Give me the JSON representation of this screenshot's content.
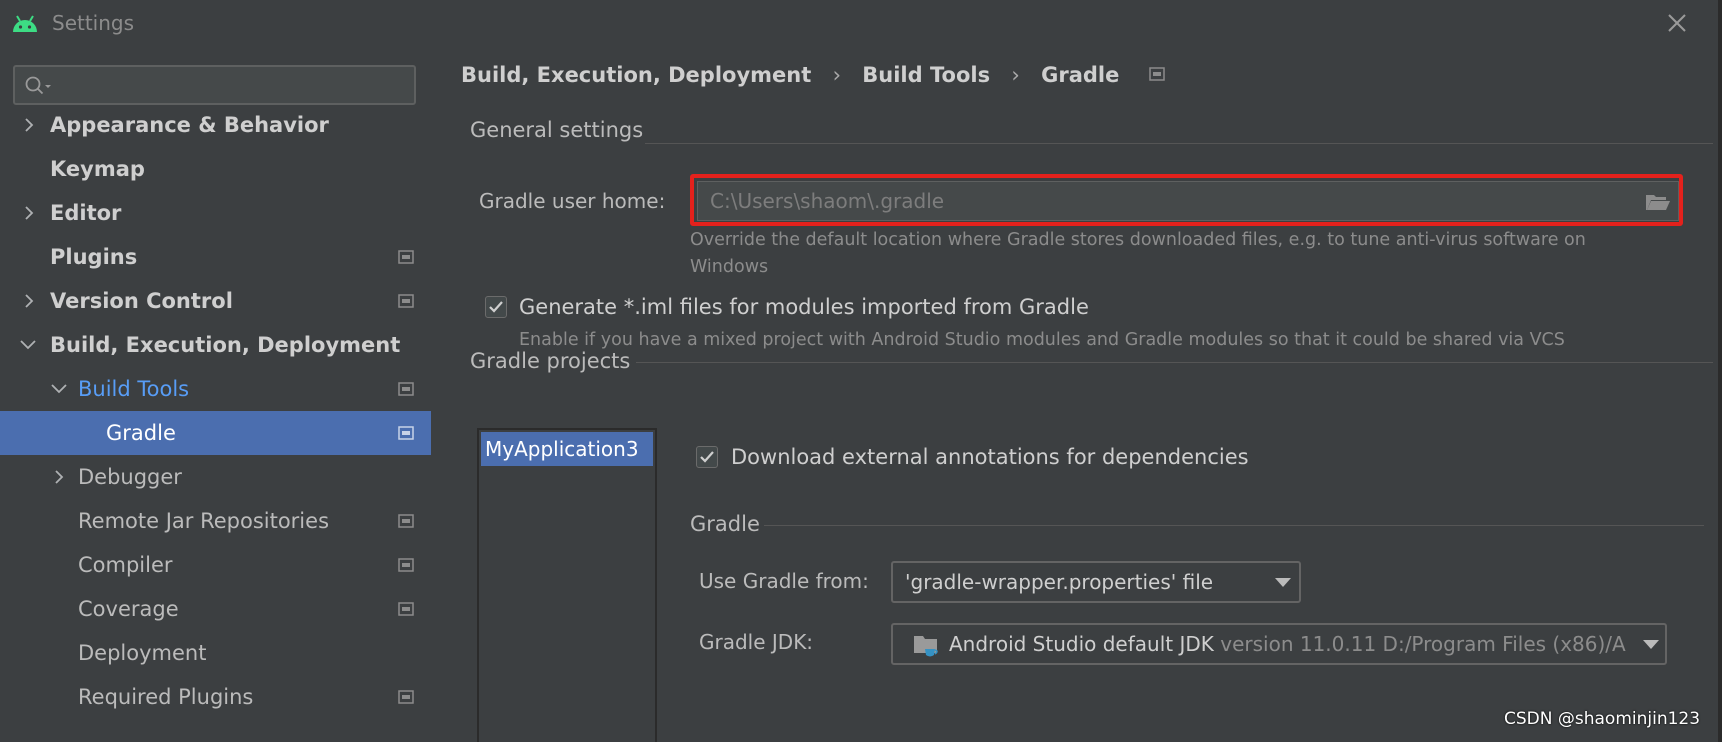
{
  "window": {
    "title": "Settings"
  },
  "search": {
    "placeholder": ""
  },
  "sidebar": {
    "items": [
      {
        "label": "Appearance & Behavior"
      },
      {
        "label": "Keymap"
      },
      {
        "label": "Editor"
      },
      {
        "label": "Plugins"
      },
      {
        "label": "Version Control"
      },
      {
        "label": "Build, Execution, Deployment"
      },
      {
        "label": "Build Tools"
      },
      {
        "label": "Gradle"
      },
      {
        "label": "Debugger"
      },
      {
        "label": "Remote Jar Repositories"
      },
      {
        "label": "Compiler"
      },
      {
        "label": "Coverage"
      },
      {
        "label": "Deployment"
      },
      {
        "label": "Required Plugins"
      }
    ]
  },
  "breadcrumb": {
    "items": [
      "Build, Execution, Deployment",
      "Build Tools",
      "Gradle"
    ],
    "separator": "›"
  },
  "general": {
    "section_title": "General settings",
    "user_home_label": "Gradle user home:",
    "user_home_value": "C:\\Users\\shaom\\.gradle",
    "user_home_hint_line1": "Override the default location where Gradle stores downloaded files, e.g. to tune anti-virus software on",
    "user_home_hint_line2": "Windows",
    "generate_iml_label": "Generate *.iml files for modules imported from Gradle",
    "generate_iml_checked": true,
    "generate_iml_hint": "Enable if you have a mixed project with Android Studio modules and Gradle modules so that it could be shared via VCS"
  },
  "projects": {
    "section_title": "Gradle projects",
    "list": [
      "MyApplication3"
    ],
    "download_annotations_label": "Download external annotations for dependencies",
    "download_annotations_checked": true,
    "gradle_section_title": "Gradle",
    "use_gradle_from_label": "Use Gradle from:",
    "use_gradle_from_value": "'gradle-wrapper.properties' file",
    "gradle_jdk_label": "Gradle JDK:",
    "gradle_jdk_name": "Android Studio default JDK",
    "gradle_jdk_detail": "version 11.0.11 D:/Program Files (x86)/A"
  },
  "watermark": {
    "text": "CSDN @shaominjin123"
  },
  "colors": {
    "accent_selection": "#4b6eaf",
    "highlight_border": "#e4211c",
    "link_blue": "#589df6",
    "android_green": "#3ddc84"
  }
}
